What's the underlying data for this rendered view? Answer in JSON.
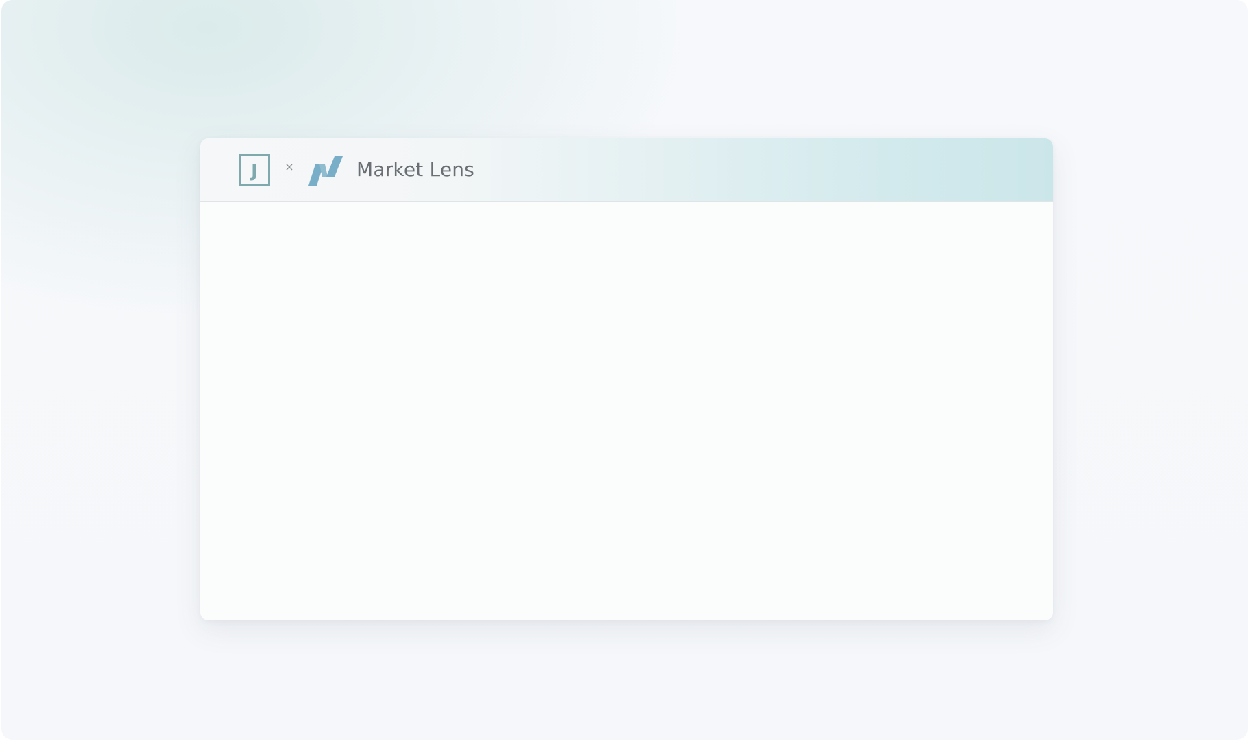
{
  "window": {
    "separator": "×",
    "title": "Market Lens"
  },
  "brand": {
    "partner_logo_letter": "J",
    "partner_logo_icon": "j-square-logo-icon",
    "product_logo_icon": "market-lens-logo-icon"
  },
  "colors": {
    "logo_teal": "#7fa9ad",
    "logo_blue": "#79aec8",
    "header_gradient_end": "#cbe6e9",
    "title_text": "#6b6f73"
  }
}
